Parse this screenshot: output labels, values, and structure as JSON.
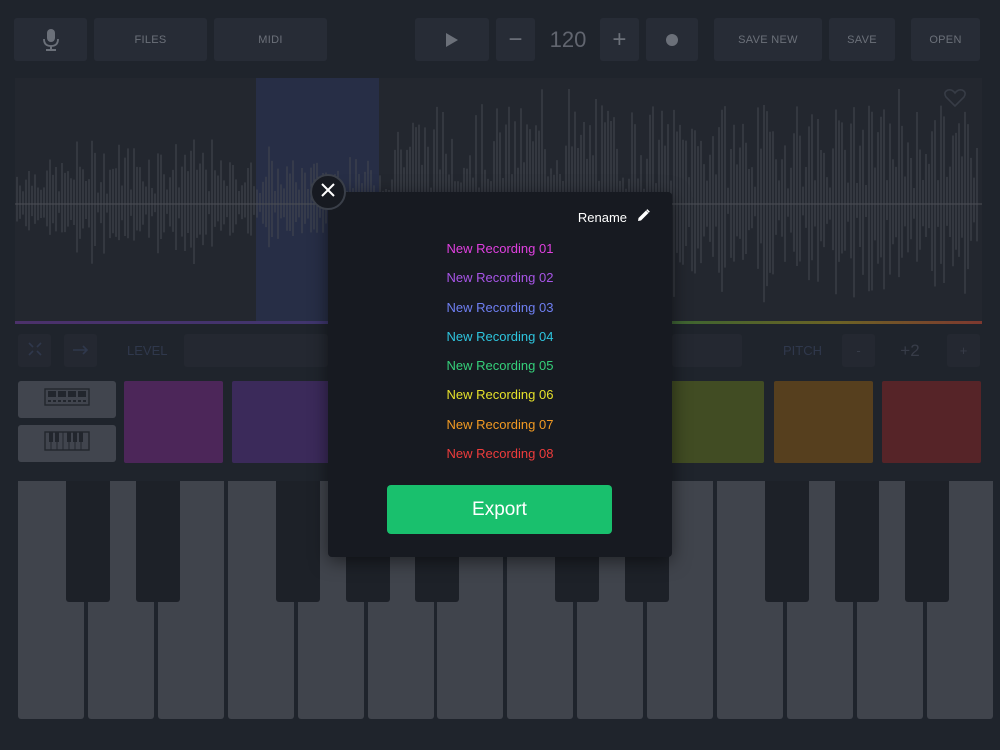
{
  "toolbar": {
    "files_label": "FILES",
    "midi_label": "MIDI",
    "minus_label": "−",
    "tempo": "120",
    "plus_label": "+",
    "save_new_label": "SAVE NEW",
    "save_label": "SAVE",
    "open_label": "OPEN"
  },
  "controls": {
    "level_label": "LEVEL",
    "pitch_label": "PITCH",
    "pitch_minus": "-",
    "pitch_value": "+2",
    "pitch_plus": "+"
  },
  "pads": {
    "colors": [
      "#6a2f7a",
      "#51357c",
      "#596927",
      "#7a5520",
      "#7a2b2f"
    ]
  },
  "modal": {
    "rename_label": "Rename",
    "recordings": [
      {
        "name": "New Recording 01",
        "color": "#e040e0"
      },
      {
        "name": "New Recording 02",
        "color": "#a855e8"
      },
      {
        "name": "New Recording 03",
        "color": "#6f7ff2"
      },
      {
        "name": "New Recording 04",
        "color": "#2ec5de"
      },
      {
        "name": "New Recording 05",
        "color": "#35d07a"
      },
      {
        "name": "New Recording 06",
        "color": "#e6e12a"
      },
      {
        "name": "New Recording 07",
        "color": "#f29a22"
      },
      {
        "name": "New Recording 08",
        "color": "#ef3c3c"
      }
    ],
    "export_label": "Export",
    "accent": "#19c06d"
  }
}
